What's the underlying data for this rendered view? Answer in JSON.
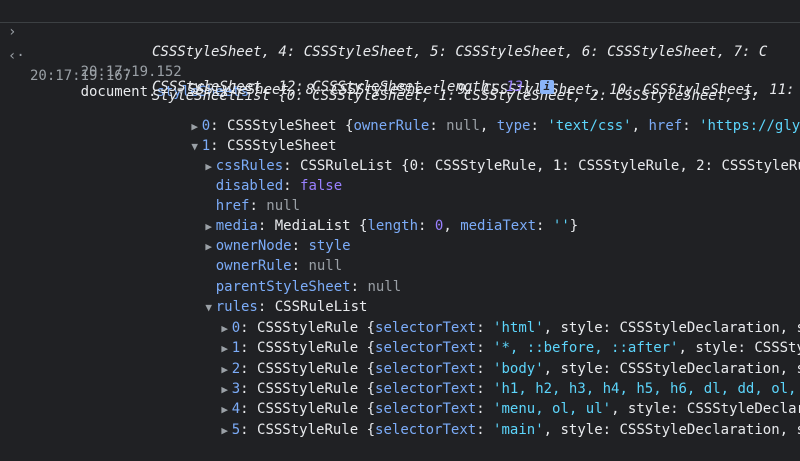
{
  "input": {
    "timestamp": "20:17:19.152",
    "command_obj": "document",
    "command_dot": ".",
    "command_prop": "styleSheets"
  },
  "output": {
    "timestamp": "20:17:19.167",
    "summary_line1": "StyleSheetList {0: CSSStyleSheet, 1: CSSStyleSheet, 2: CSSStyleSheet, 3:",
    "summary_line2": "CSSStyleSheet, 4: CSSStyleSheet, 5: CSSStyleSheet, 6: CSSStyleSheet, 7: C",
    "summary_line3": "SSStyleSheet, 8: CSSStyleSheet, 9: CSSStyleSheet, 10: CSSStyleSheet, 11:",
    "summary_line4_a": "CSSStyleSheet, 12: CSSStyleSheet, length: ",
    "summary_line4_num": "13",
    "summary_line4_b": "}",
    "info_glyph": "i"
  },
  "tree": {
    "item0": {
      "key": "0",
      "rest_a": "CSSStyleSheet {",
      "k1": "ownerRule",
      "v1": "null",
      "k2": "type",
      "v2": "'text/css'",
      "k3": "href",
      "v3": "'https://glyp"
    },
    "item1": {
      "key": "1",
      "label": "CSSStyleSheet"
    },
    "cssRules": {
      "key": "cssRules",
      "type": "CSSRuleList {",
      "entries": "0: CSSStyleRule, 1: CSSStyleRule, 2: CSSStyleRu"
    },
    "disabled": {
      "key": "disabled",
      "value": "false"
    },
    "href": {
      "key": "href",
      "value": "null"
    },
    "media": {
      "key": "media",
      "type": "MediaList {",
      "k1": "length",
      "v1": "0",
      "k2": "mediaText",
      "v2": "''",
      "close": "}"
    },
    "ownerNode": {
      "key": "ownerNode",
      "value": "style"
    },
    "ownerRule": {
      "key": "ownerRule",
      "value": "null"
    },
    "parentStyleSheet": {
      "key": "parentStyleSheet",
      "value": "null"
    },
    "rules": {
      "key": "rules",
      "label": "CSSRuleList"
    },
    "rule_items": [
      {
        "key": "0",
        "type": "CSSStyleRule {",
        "sel": "'html'",
        "tail": ", style: CSSStyleDeclaration, s"
      },
      {
        "key": "1",
        "type": "CSSStyleRule {",
        "sel": "'*, ::before, ::after'",
        "tail": ", style: CSSSty"
      },
      {
        "key": "2",
        "type": "CSSStyleRule {",
        "sel": "'body'",
        "tail": ", style: CSSStyleDeclaration, s"
      },
      {
        "key": "3",
        "type": "CSSStyleRule {",
        "sel": "'h1, h2, h3, h4, h5, h6, dl, dd, ol,",
        "tail": ""
      },
      {
        "key": "4",
        "type": "CSSStyleRule {",
        "sel": "'menu, ol, ul'",
        "tail": ", style: CSSStyleDeclar"
      },
      {
        "key": "5",
        "type": "CSSStyleRule {",
        "sel": "'main'",
        "tail": ", style: CSSStyleDeclaration, s"
      }
    ],
    "selector_key": "selectorText"
  }
}
